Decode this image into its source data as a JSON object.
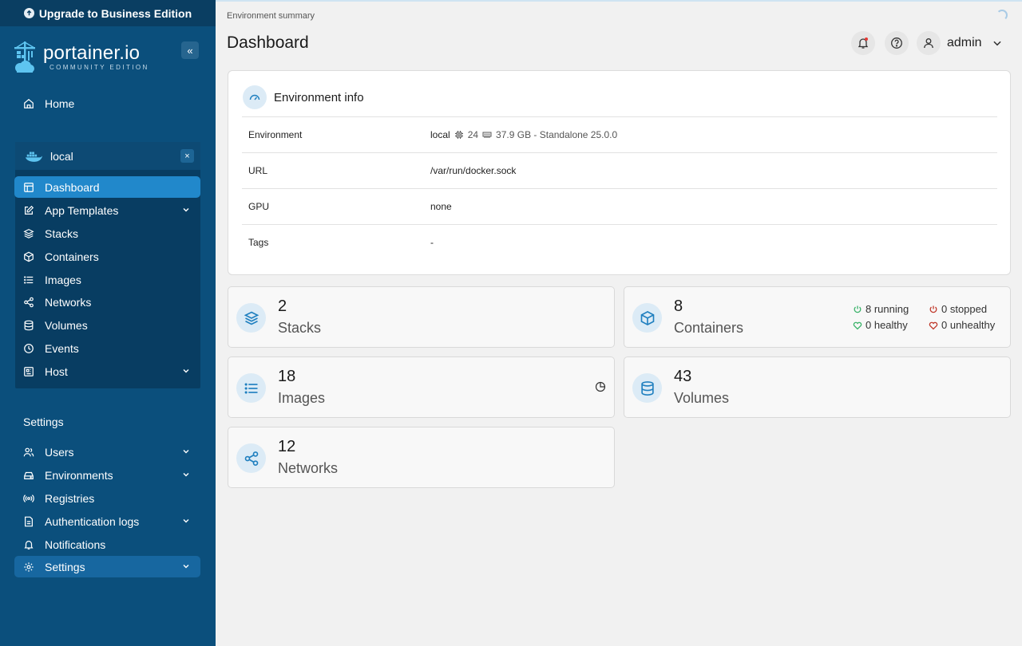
{
  "colors": {
    "sidebar_bg": "#0b4f7c",
    "active_bg": "#2188cb",
    "accent": "#1f7fbf",
    "running": "#3bb36a",
    "stopped": "#c0392b"
  },
  "upgrade": {
    "label": "Upgrade to Business Edition",
    "icon": "arrow-up-circle-icon"
  },
  "brand": {
    "name": "portainer.io",
    "edition": "COMMUNITY EDITION"
  },
  "sidebar": {
    "home": "Home",
    "environment": {
      "name": "local"
    },
    "env_items": [
      {
        "label": "Dashboard",
        "icon": "dashboard-icon"
      },
      {
        "label": "App Templates",
        "icon": "edit-icon"
      },
      {
        "label": "Stacks",
        "icon": "layers-icon"
      },
      {
        "label": "Containers",
        "icon": "box-icon"
      },
      {
        "label": "Images",
        "icon": "list-icon"
      },
      {
        "label": "Networks",
        "icon": "share-icon"
      },
      {
        "label": "Volumes",
        "icon": "database-icon"
      },
      {
        "label": "Events",
        "icon": "clock-icon"
      },
      {
        "label": "Host",
        "icon": "host-icon"
      }
    ],
    "settings_title": "Settings",
    "settings_items": [
      {
        "label": "Users",
        "icon": "users-icon"
      },
      {
        "label": "Environments",
        "icon": "drive-icon"
      },
      {
        "label": "Registries",
        "icon": "radio-icon"
      },
      {
        "label": "Authentication logs",
        "icon": "file-icon"
      },
      {
        "label": "Notifications",
        "icon": "bell-icon"
      },
      {
        "label": "Settings",
        "icon": "gear-icon"
      }
    ]
  },
  "header": {
    "breadcrumb": "Environment summary",
    "title": "Dashboard",
    "user": "admin"
  },
  "env_info": {
    "title": "Environment info",
    "rows": [
      {
        "key": "Environment",
        "value": "local",
        "cpu": "24",
        "memory": "37.9 GB - Standalone 25.0.0"
      },
      {
        "key": "URL",
        "value": "/var/run/docker.sock"
      },
      {
        "key": "GPU",
        "value": "none"
      },
      {
        "key": "Tags",
        "value": "-"
      }
    ]
  },
  "stats": {
    "stacks": {
      "count": "2",
      "label": "Stacks"
    },
    "containers": {
      "count": "8",
      "label": "Containers",
      "running": "8 running",
      "stopped": "0 stopped",
      "healthy": "0 healthy",
      "unhealthy": "0 unhealthy"
    },
    "images": {
      "count": "18",
      "label": "Images"
    },
    "volumes": {
      "count": "43",
      "label": "Volumes"
    },
    "networks": {
      "count": "12",
      "label": "Networks"
    }
  }
}
